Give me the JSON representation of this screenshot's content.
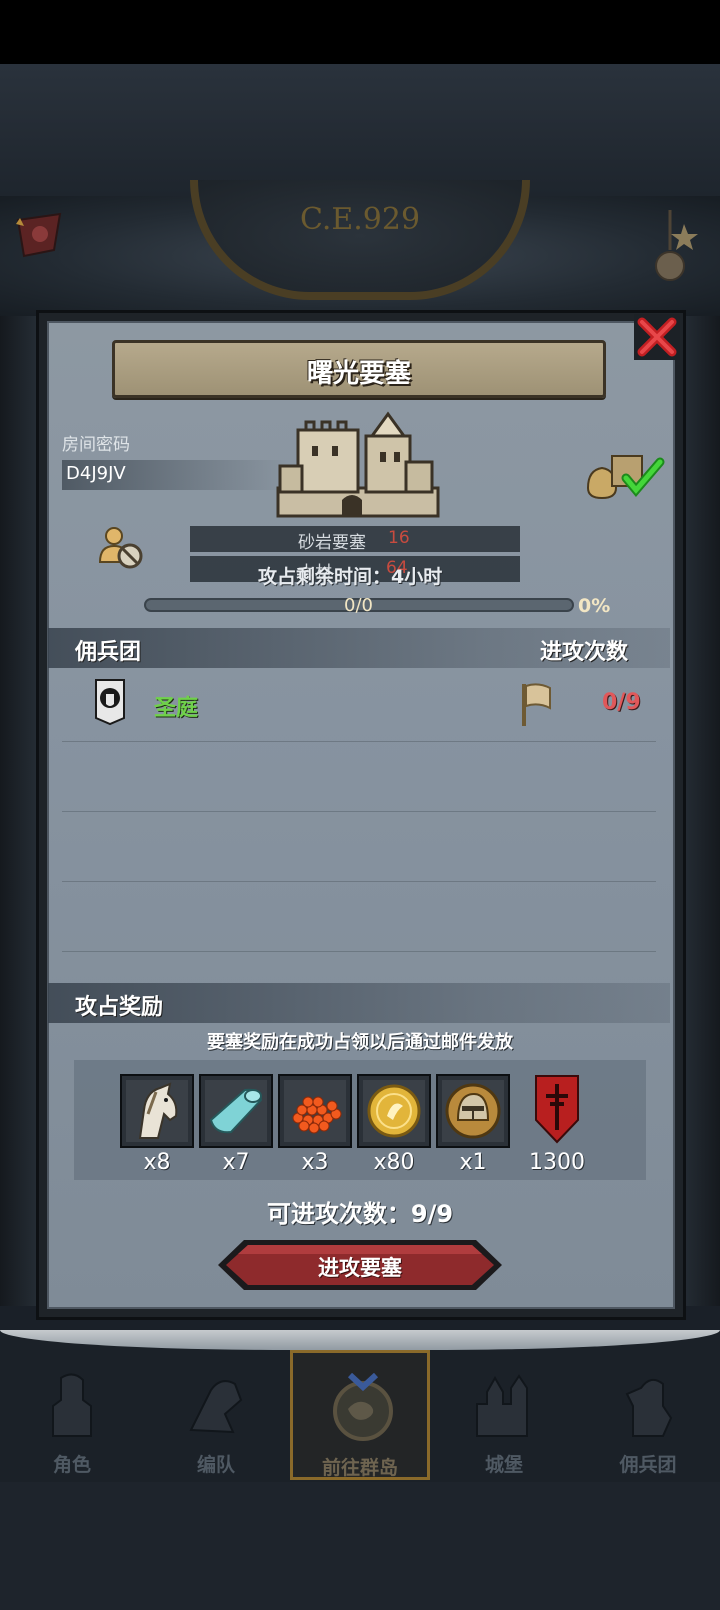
{
  "world": {
    "year": "C.E.929"
  },
  "dialog": {
    "title": "曙光要塞",
    "room_label": "房间密码",
    "room_code": "D4J9JV",
    "resources": [
      {
        "name": "砂岩要塞",
        "value": "16"
      },
      {
        "name": "木材",
        "value": "64"
      }
    ],
    "time_text": "攻占剩余时间：4小时",
    "progress": {
      "text": "0/0",
      "pct": "0%",
      "fraction": 0
    },
    "mercenary_section": {
      "title": "佣兵团",
      "right": "进攻次数"
    },
    "guilds": [
      {
        "name": "圣庭",
        "attacks": "0/9"
      }
    ],
    "reward_section": {
      "title": "攻占奖励"
    },
    "reward_note": "要塞奖励在成功占领以后通过邮件发放",
    "rewards": [
      {
        "icon": "horse-icon",
        "count": "x8"
      },
      {
        "icon": "cloth-icon",
        "count": "x7"
      },
      {
        "icon": "caviar-icon",
        "count": "x3"
      },
      {
        "icon": "gold-coin-icon",
        "count": "x80"
      },
      {
        "icon": "helmet-icon",
        "count": "x1"
      },
      {
        "icon": "guild-shield-icon",
        "count": "1300"
      }
    ],
    "attack_remaining": "可进攻次数：9/9",
    "attack_button": "进攻要塞"
  },
  "nav": [
    {
      "label": "角色",
      "icon": "knight-icon"
    },
    {
      "label": "编队",
      "icon": "formation-icon"
    },
    {
      "label": "前往群岛",
      "icon": "island-map-icon"
    },
    {
      "label": "城堡",
      "icon": "castle-icon"
    },
    {
      "label": "佣兵团",
      "icon": "mercenary-icon"
    }
  ],
  "colors": {
    "gold": "#d9b257",
    "green": "#6fd14a",
    "red": "#e0585a",
    "button": "#8e2a2c"
  }
}
